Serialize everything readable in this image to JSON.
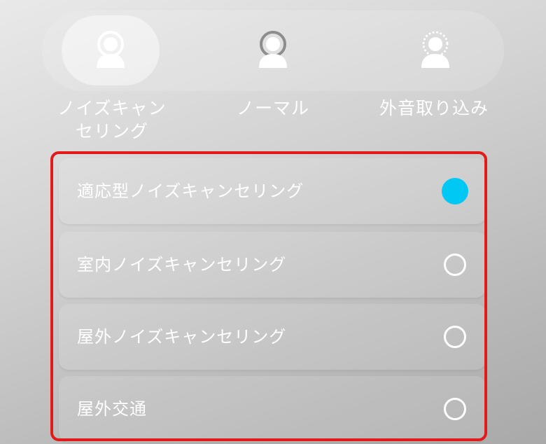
{
  "modes": {
    "items": [
      {
        "label": "ノイズキャン\nセリング",
        "icon": "person-noise-cancel-icon",
        "selected": true
      },
      {
        "label": "ノーマル",
        "icon": "person-normal-icon",
        "selected": false
      },
      {
        "label": "外音取り込み",
        "icon": "person-ambient-icon",
        "selected": false
      }
    ]
  },
  "nc_options": {
    "items": [
      {
        "label": "適応型ノイズキャンセリング",
        "selected": true
      },
      {
        "label": "室内ノイズキャンセリング",
        "selected": false
      },
      {
        "label": "屋外ノイズキャンセリング",
        "selected": false
      },
      {
        "label": "屋外交通",
        "selected": false
      }
    ]
  },
  "colors": {
    "accent": "#00c8f5",
    "highlight_border": "#e21a1a"
  }
}
